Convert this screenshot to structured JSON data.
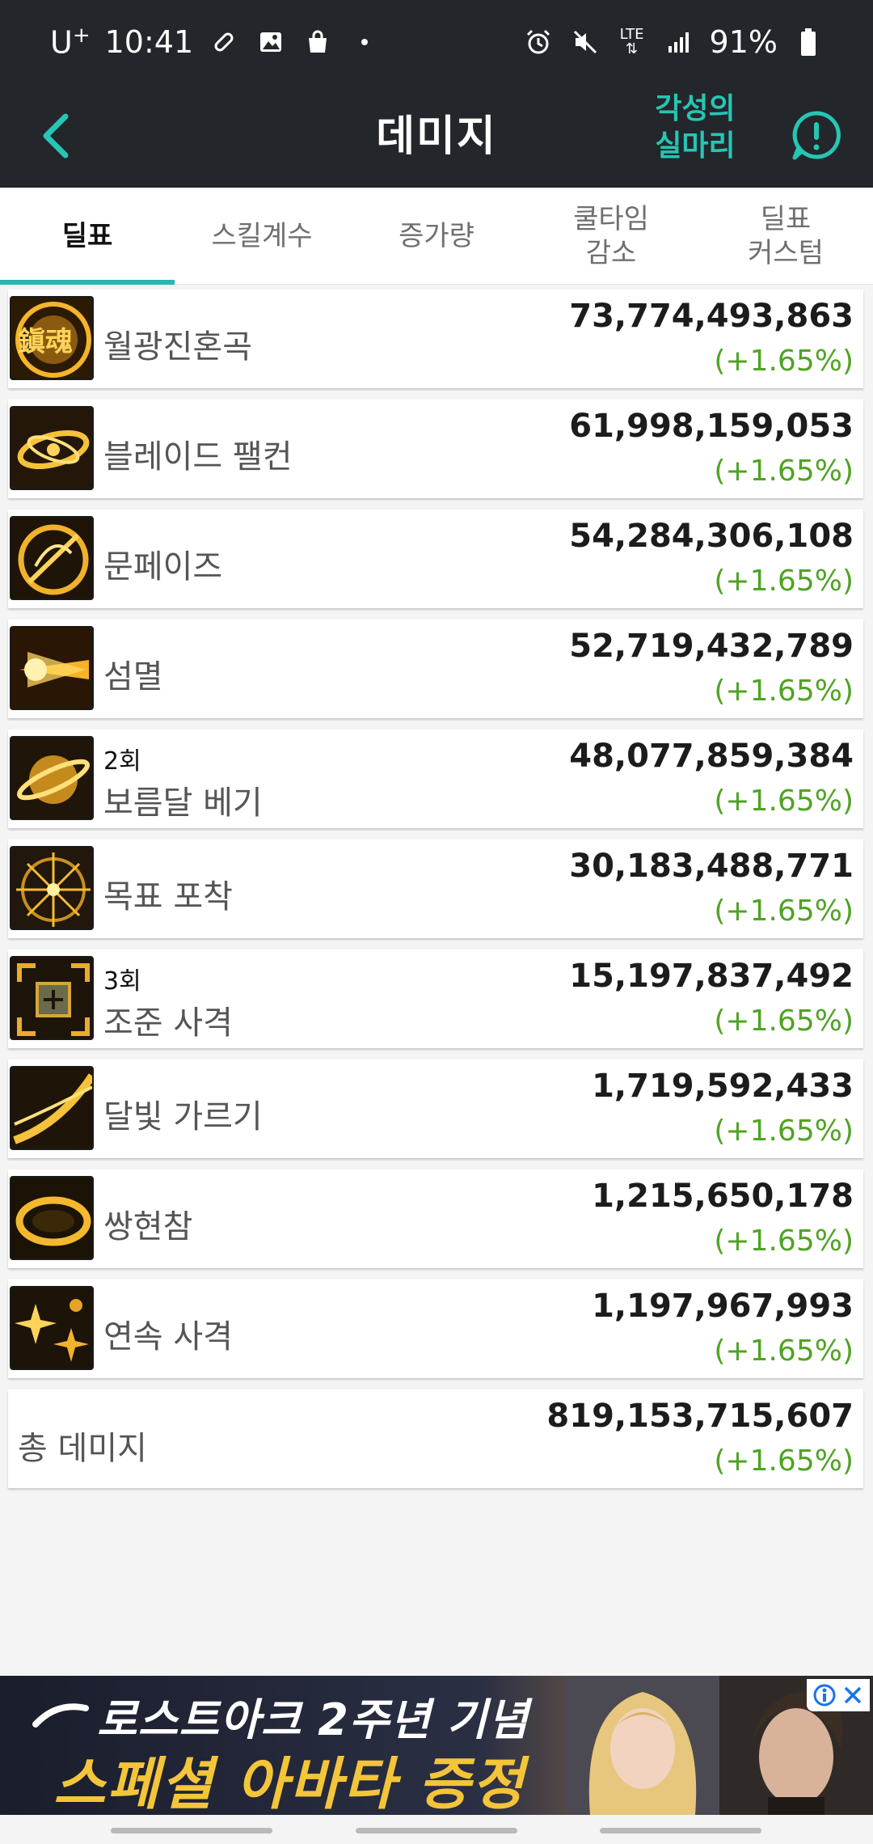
{
  "status_bar": {
    "carrier": "U",
    "carrier_plus": "+",
    "time": "10:41",
    "network": "LTE",
    "battery": "91%",
    "icons": [
      "bandage-icon",
      "image-icon",
      "shopping-bag-icon",
      "dot-icon",
      "alarm-icon",
      "mute-icon",
      "lte-icon",
      "signal-icon",
      "battery-icon"
    ]
  },
  "app_bar": {
    "title": "데미지",
    "awaken_link_line1": "각성의",
    "awaken_link_line2": "실마리",
    "accent_color": "#26c6b4",
    "background": "#23262b"
  },
  "tabs": [
    {
      "label": "딜표",
      "active": true
    },
    {
      "label": "스킬계수",
      "active": false
    },
    {
      "label": "증가량",
      "active": false
    },
    {
      "label_line1": "쿨타임",
      "label_line2": "감소",
      "active": false
    },
    {
      "label_line1": "딜표",
      "label_line2": "커스텀",
      "active": false
    }
  ],
  "skills": [
    {
      "name": "월광진혼곡",
      "hits": "",
      "damage": "73,774,493,863",
      "change": "(+1.65%)",
      "icon": "moonlight-requiem-icon"
    },
    {
      "name": "블레이드 팰컨",
      "hits": "",
      "damage": "61,998,159,053",
      "change": "(+1.65%)",
      "icon": "blade-falcon-icon"
    },
    {
      "name": "문페이즈",
      "hits": "",
      "damage": "54,284,306,108",
      "change": "(+1.65%)",
      "icon": "moon-phase-icon"
    },
    {
      "name": "섬멸",
      "hits": "",
      "damage": "52,719,432,789",
      "change": "(+1.65%)",
      "icon": "annihilation-icon"
    },
    {
      "name": "보름달 베기",
      "hits": "2회",
      "damage": "48,077,859,384",
      "change": "(+1.65%)",
      "icon": "full-moon-slash-icon"
    },
    {
      "name": "목표 포착",
      "hits": "",
      "damage": "30,183,488,771",
      "change": "(+1.65%)",
      "icon": "target-lock-icon"
    },
    {
      "name": "조준 사격",
      "hits": "3회",
      "damage": "15,197,837,492",
      "change": "(+1.65%)",
      "icon": "aimed-shot-icon"
    },
    {
      "name": "달빛 가르기",
      "hits": "",
      "damage": "1,719,592,433",
      "change": "(+1.65%)",
      "icon": "moonlight-cut-icon"
    },
    {
      "name": "쌍현참",
      "hits": "",
      "damage": "1,215,650,178",
      "change": "(+1.65%)",
      "icon": "twin-slash-icon"
    },
    {
      "name": "연속 사격",
      "hits": "",
      "damage": "1,197,967,993",
      "change": "(+1.65%)",
      "icon": "rapid-fire-icon"
    }
  ],
  "total": {
    "label": "총 데미지",
    "damage": "819,153,715,607",
    "change": "(+1.65%)"
  },
  "ad": {
    "line1": "로스트아크 2주년 기념",
    "line2": "스페셜 아바타 증정"
  },
  "colors": {
    "positive_change": "#4fa324",
    "tab_indicator": "#26b8b0"
  }
}
